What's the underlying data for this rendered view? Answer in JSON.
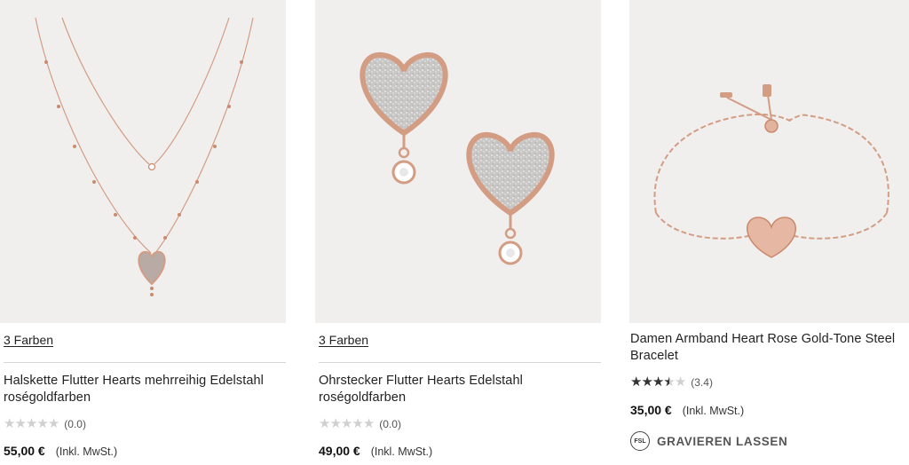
{
  "products": [
    {
      "colors_label": "3 Farben",
      "title": "Halskette Flutter Hearts mehrreihig Edelstahl roségoldfarben",
      "rating_count": "(0.0)",
      "rating": 0,
      "price": "55,00 €",
      "tax_note": "(Inkl. MwSt.)"
    },
    {
      "colors_label": "3 Farben",
      "title": "Ohrstecker Flutter Hearts Edelstahl roségoldfarben",
      "rating_count": "(0.0)",
      "rating": 0,
      "price": "49,00 €",
      "tax_note": "(Inkl. MwSt.)"
    },
    {
      "title": "Damen Armband Heart Rose Gold-Tone Steel Bracelet",
      "rating_count": "(3.4)",
      "rating": 3.4,
      "price": "35,00 €",
      "tax_note": "(Inkl. MwSt.)",
      "engrave_label": "GRAVIEREN LASSEN",
      "engrave_icon_text": "FSL"
    }
  ],
  "colors": {
    "image_bg": "#f1efee",
    "rose_gold": "#d9a48b",
    "divider": "#d6d6d6"
  }
}
